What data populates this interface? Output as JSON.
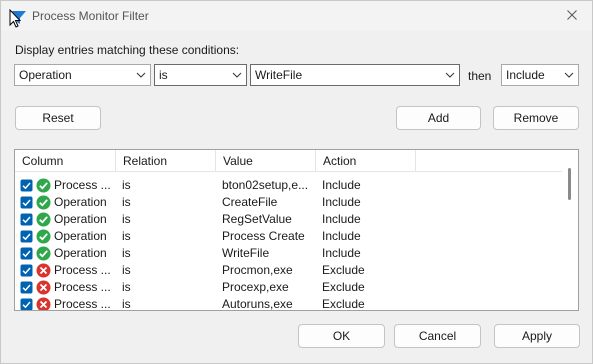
{
  "window": {
    "title": "Process Monitor Filter",
    "close_icon": "close-icon",
    "app_icon": "process-monitor-filter-icon"
  },
  "conditions": {
    "label": "Display entries matching these conditions:",
    "column_value": "Operation",
    "relation_value": "is",
    "value_value": "WriteFile",
    "then_label": "then",
    "action_value": "Include"
  },
  "buttons": {
    "reset": "Reset",
    "add": "Add",
    "remove": "Remove",
    "ok": "OK",
    "cancel": "Cancel",
    "apply": "Apply"
  },
  "list": {
    "headers": [
      "Column",
      "Relation",
      "Value",
      "Action"
    ],
    "rows": [
      {
        "checked": true,
        "status": "include",
        "column": "Process ...",
        "relation": "is",
        "value": "bton02setup,e...",
        "action": "Include"
      },
      {
        "checked": true,
        "status": "include",
        "column": "Operation",
        "relation": "is",
        "value": "CreateFile",
        "action": "Include"
      },
      {
        "checked": true,
        "status": "include",
        "column": "Operation",
        "relation": "is",
        "value": "RegSetValue",
        "action": "Include"
      },
      {
        "checked": true,
        "status": "include",
        "column": "Operation",
        "relation": "is",
        "value": "Process Create",
        "action": "Include"
      },
      {
        "checked": true,
        "status": "include",
        "column": "Operation",
        "relation": "is",
        "value": "WriteFile",
        "action": "Include"
      },
      {
        "checked": true,
        "status": "exclude",
        "column": "Process ...",
        "relation": "is",
        "value": "Procmon,exe",
        "action": "Exclude"
      },
      {
        "checked": true,
        "status": "exclude",
        "column": "Process ...",
        "relation": "is",
        "value": "Procexp,exe",
        "action": "Exclude"
      },
      {
        "checked": true,
        "status": "exclude",
        "column": "Process ...",
        "relation": "is",
        "value": "Autoruns,exe",
        "action": "Exclude"
      }
    ]
  },
  "colors": {
    "include_green": "#2ea84a",
    "exclude_red": "#d9352f",
    "checkbox_blue": "#0063b1"
  }
}
